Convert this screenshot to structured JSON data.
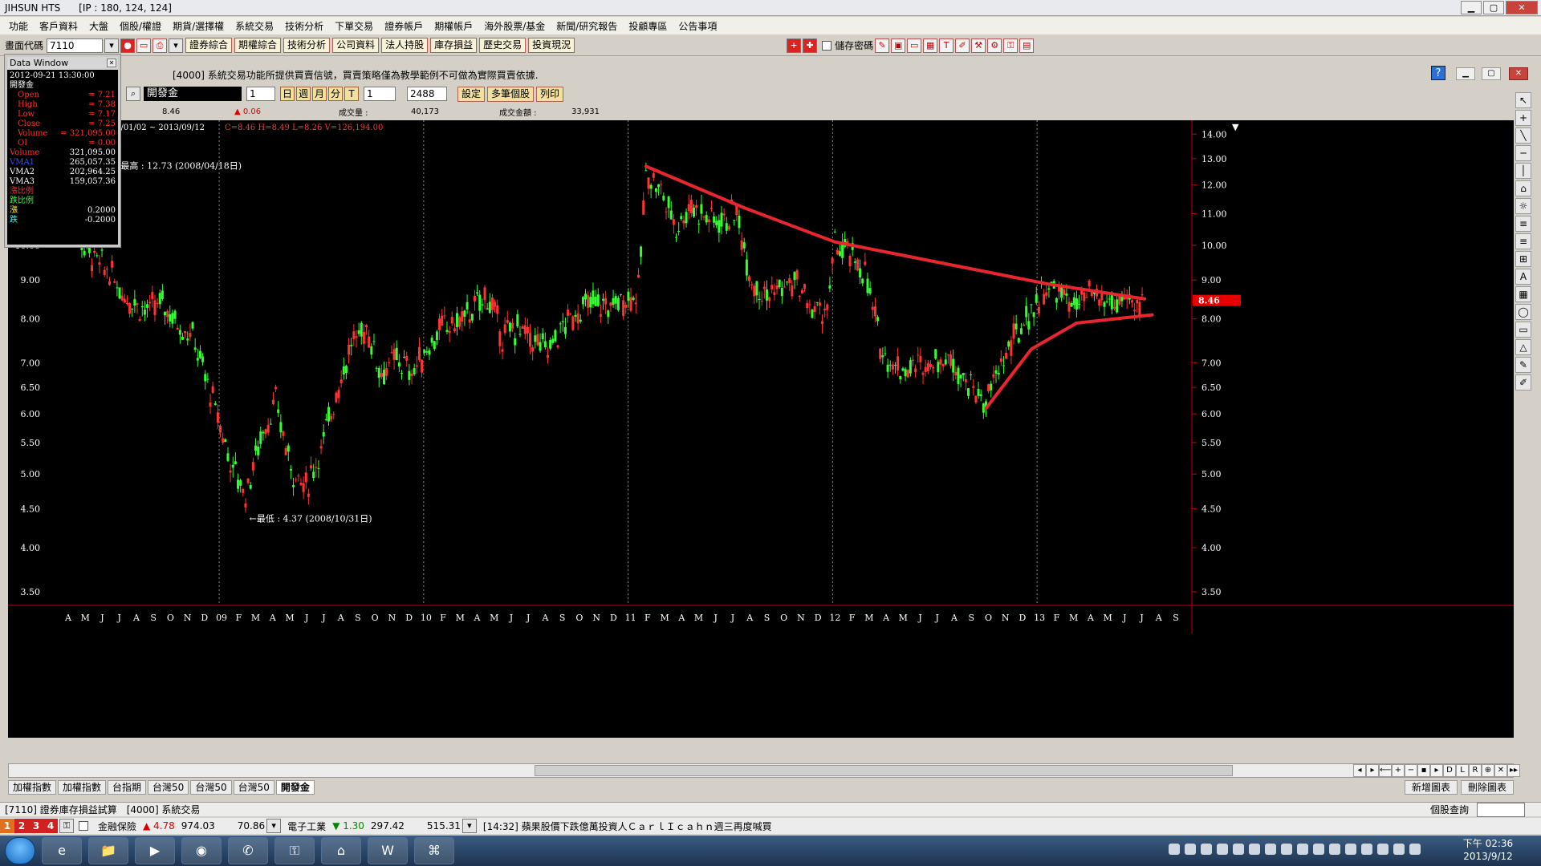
{
  "app": {
    "title": "JIHSUN HTS      [IP : 180, 124, 124]"
  },
  "menu": [
    "功能",
    "客戶資料",
    "大盤",
    "個股/權證",
    "期貨/選擇權",
    "系統交易",
    "技術分析",
    "下單交易",
    "證券帳戶",
    "期權帳戶",
    "海外股票/基金",
    "新聞/研究報告",
    "投顧專區",
    "公告事項"
  ],
  "toolbar": {
    "code_label": "畫面代碼",
    "code_value": "7110",
    "buttons": [
      "證券綜合",
      "期權綜合",
      "技術分析",
      "公司資料",
      "法人持股",
      "庫存損益",
      "歷史交易",
      "投資現況"
    ],
    "save_password_label": "儲存密碼"
  },
  "chart_window": {
    "notice": "[4000] 系統交易功能所提供買賣信號，買賣策略僅為教學範例不可做為實際買賣依據.",
    "help": "?"
  },
  "controls": {
    "stock_name": "開發金",
    "period_value": "1",
    "period_buttons": [
      "日",
      "週",
      "月",
      "分",
      "T"
    ],
    "interval_value": "1",
    "bars_value": "2488",
    "actions": [
      "設定",
      "多筆個股",
      "列印"
    ]
  },
  "stats": {
    "last": "8.46",
    "change": "▲ 0.06",
    "volume_label": "成交量 :",
    "volume": "40,173",
    "amount_label": "成交金額 :",
    "amount": "33,931"
  },
  "data_window": {
    "title": "Data Window",
    "datetime": "2012-09-21   13:30:00",
    "name": "開發金",
    "rows": [
      {
        "label": "Open",
        "value": "= 7.21",
        "color": "#ff3030"
      },
      {
        "label": "High",
        "value": "= 7.38",
        "color": "#ff3030"
      },
      {
        "label": "Low",
        "value": "= 7.17",
        "color": "#ff3030"
      },
      {
        "label": "Close",
        "value": "= 7.25",
        "color": "#ff3030"
      },
      {
        "label": "Volume",
        "value": "= 321,095.00",
        "color": "#ff3030"
      },
      {
        "label": "OI",
        "value": "= 0.00",
        "color": "#ff3030"
      }
    ],
    "vol_rows": [
      {
        "label": "Volume",
        "value": "321,095.00",
        "color": "#ff3030"
      },
      {
        "label": "VMA1",
        "value": "265,057.35",
        "color": "#3050ff"
      },
      {
        "label": "VMA2",
        "value": "202,964.25",
        "color": "#ffffff"
      },
      {
        "label": "VMA3",
        "value": "159,057.36",
        "color": "#ffffff"
      }
    ],
    "ratio_rows": [
      {
        "label": "漲比例",
        "value": "",
        "color": "#ff3030"
      },
      {
        "label": "跌比例",
        "value": "",
        "color": "#30ff30"
      },
      {
        "label": "漲",
        "value": "0.2000",
        "color": "#ffff40"
      },
      {
        "label": "跌",
        "value": "-0.2000",
        "color": "#30ffff"
      }
    ]
  },
  "chart_data": {
    "type": "candlestick",
    "header_range": "2004/01/02 ~ 2013/09/12",
    "header_ohlc": "C=8.46 H=8.49 L=8.26 V=126,194.00",
    "yscale": "log",
    "ylim": [
      3.4,
      14.6
    ],
    "y_ticks": [
      "14.00",
      "13.00",
      "12.00",
      "11.00",
      "10.00",
      "9.00",
      "8.00",
      "7.00",
      "6.50",
      "6.00",
      "5.50",
      "5.00",
      "4.50",
      "4.00",
      "3.50"
    ],
    "x_labels": [
      "A",
      "M",
      "J",
      "J",
      "A",
      "S",
      "O",
      "N",
      "D",
      "09",
      "F",
      "M",
      "A",
      "M",
      "J",
      "J",
      "A",
      "S",
      "O",
      "N",
      "D",
      "10",
      "F",
      "M",
      "A",
      "M",
      "J",
      "J",
      "A",
      "S",
      "O",
      "N",
      "D",
      "11",
      "F",
      "M",
      "A",
      "M",
      "J",
      "J",
      "A",
      "S",
      "O",
      "N",
      "D",
      "12",
      "F",
      "M",
      "A",
      "M",
      "J",
      "J",
      "A",
      "S",
      "O",
      "N",
      "D",
      "13",
      "F",
      "M",
      "A",
      "M",
      "J",
      "J",
      "A",
      "S"
    ],
    "year_separators": [
      "09",
      "10",
      "11",
      "12",
      "13"
    ],
    "price_path": [
      [
        0,
        10.9
      ],
      [
        2,
        10.2
      ],
      [
        4,
        9.6
      ],
      [
        6,
        9.2
      ],
      [
        8,
        8.6
      ],
      [
        11,
        8.2
      ],
      [
        13,
        8.4
      ],
      [
        15,
        7.9
      ],
      [
        17,
        7.6
      ],
      [
        20,
        6.1
      ],
      [
        22,
        5.2
      ],
      [
        24,
        4.7
      ],
      [
        26,
        5.6
      ],
      [
        28,
        6.2
      ],
      [
        30,
        5.1
      ],
      [
        32,
        4.8
      ],
      [
        34,
        5.4
      ],
      [
        36,
        6.4
      ],
      [
        38,
        7.4
      ],
      [
        40,
        7.8
      ],
      [
        42,
        6.8
      ],
      [
        44,
        7.1
      ],
      [
        46,
        6.8
      ],
      [
        48,
        7.3
      ],
      [
        50,
        7.8
      ],
      [
        52,
        7.9
      ],
      [
        54,
        8.2
      ],
      [
        56,
        8.6
      ],
      [
        58,
        7.6
      ],
      [
        60,
        7.8
      ],
      [
        62,
        7.5
      ],
      [
        64,
        7.3
      ],
      [
        66,
        7.8
      ],
      [
        68,
        8.2
      ],
      [
        70,
        8.4
      ],
      [
        72,
        8.3
      ],
      [
        74,
        8.5
      ],
      [
        76,
        8.7
      ],
      [
        77,
        12.5
      ],
      [
        79,
        11.8
      ],
      [
        81,
        10.6
      ],
      [
        83,
        11.3
      ],
      [
        85,
        10.9
      ],
      [
        87,
        10.8
      ],
      [
        89,
        11.0
      ],
      [
        91,
        9.0
      ],
      [
        93,
        8.6
      ],
      [
        95,
        8.8
      ],
      [
        97,
        8.9
      ],
      [
        99,
        8.2
      ],
      [
        101,
        8.2
      ],
      [
        102,
        10.0
      ],
      [
        104,
        9.7
      ],
      [
        106,
        9.2
      ],
      [
        108,
        7.4
      ],
      [
        110,
        6.9
      ],
      [
        112,
        6.9
      ],
      [
        114,
        7.0
      ],
      [
        116,
        7.1
      ],
      [
        118,
        7.0
      ],
      [
        120,
        6.5
      ],
      [
        122,
        6.2
      ],
      [
        124,
        7.0
      ],
      [
        126,
        7.6
      ],
      [
        128,
        8.2
      ],
      [
        130,
        8.8
      ],
      [
        132,
        8.6
      ],
      [
        134,
        8.3
      ],
      [
        136,
        8.6
      ],
      [
        138,
        8.4
      ],
      [
        140,
        8.4
      ],
      [
        142,
        8.3
      ],
      [
        143,
        8.46
      ]
    ],
    "annotations": [
      {
        "text": "←最高 : 12.73 (2008/04/18日)",
        "x": 6.5,
        "y": 12.73
      },
      {
        "text": "←最低 : 4.37 (2008/10/31日)",
        "x": 24.5,
        "y": 4.37
      }
    ],
    "current_price_tag": "8.46",
    "trendlines": [
      {
        "color": "#e8262e",
        "points": [
          [
            77,
            12.7
          ],
          [
            90,
            11.2
          ],
          [
            102,
            10.1
          ],
          [
            130,
            8.9
          ],
          [
            143,
            8.5
          ]
        ]
      },
      {
        "color": "#e8262e",
        "points": [
          [
            122,
            6.1
          ],
          [
            128,
            7.3
          ],
          [
            134,
            7.9
          ],
          [
            144,
            8.1
          ]
        ]
      }
    ]
  },
  "tools": [
    "↖",
    "+",
    "╲",
    "─",
    "│",
    "⌂",
    "☼",
    "≡",
    "≡",
    "⊞",
    "A",
    "▦",
    "◯",
    "▭",
    "△",
    "✎",
    "✐"
  ],
  "scroll": {
    "nav": [
      "◂",
      "▸",
      "⟵",
      "+",
      "−",
      "▪",
      "▸",
      "D",
      "L",
      "R",
      "⊕",
      "✕",
      "▸▸"
    ]
  },
  "tabs": [
    "加權指數",
    "加權指數",
    "台指期",
    "台灣50",
    "台灣50",
    "台灣50",
    "開發金"
  ],
  "chart_actions": [
    "新增圖表",
    "刪除圖表"
  ],
  "status": {
    "items": [
      "[7110] 證券庫存損益試算",
      "[4000] 系統交易"
    ],
    "right": "個股查詢"
  },
  "ticker": {
    "tabs": [
      "1",
      "2",
      "3",
      "4"
    ],
    "item1_name": "金融保險",
    "item1_change": "▲ 4.78",
    "item1_value": "974.03",
    "item1_vol": "70.86",
    "item2_name": "電子工業",
    "item2_change": "▼ 1.30",
    "item2_value": "297.42",
    "item2_vol": "515.31",
    "news": "[14:32] 蘋果股價下跌億萬投資人ＣａｒｌＩｃａｈｎ週三再度喊買"
  },
  "taskbar": {
    "apps": [
      "e",
      "📁",
      "▶",
      "◉",
      "✆",
      "⚿",
      "⌂",
      "W",
      "⌘"
    ],
    "time": "下午 02:36",
    "date": "2013/9/12"
  },
  "colors": {
    "up": "#ff3333",
    "down": "#33ff33",
    "trend": "#e8262e",
    "bg": "#000000"
  }
}
